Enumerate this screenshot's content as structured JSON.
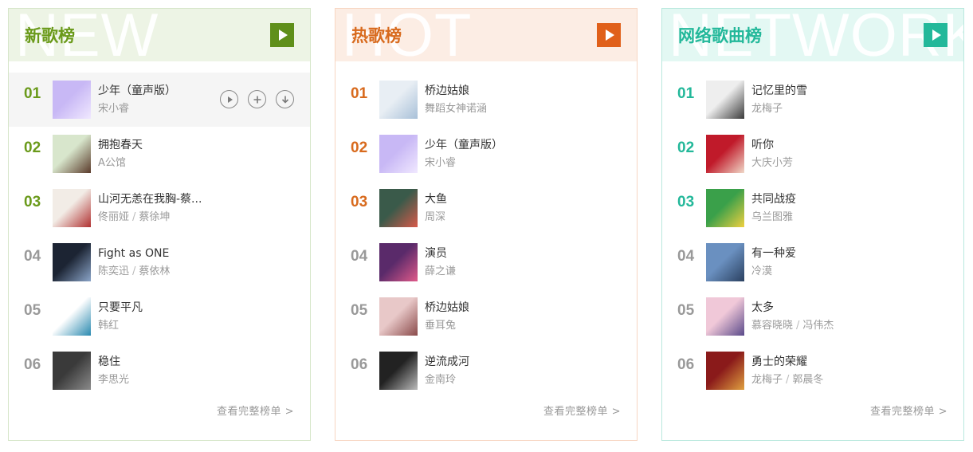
{
  "boards": [
    {
      "key": "new",
      "watermark": "NEW",
      "title": "新歌榜",
      "more_label": "查看完整榜单 >",
      "songs": [
        {
          "rank": "01",
          "name": "少年（童声版）",
          "artists": [
            "宋小睿"
          ],
          "cover": [
            "#c8b8f5",
            "#f0e8ff"
          ]
        },
        {
          "rank": "02",
          "name": "拥抱春天",
          "artists": [
            "A公馆"
          ],
          "cover": [
            "#d8e6cc",
            "#5a3a2a"
          ]
        },
        {
          "rank": "03",
          "name": "山河无恙在我胸-蔡...",
          "artists": [
            "佟丽娅",
            "蔡徐坤"
          ],
          "cover": [
            "#f2ece6",
            "#b03030"
          ]
        },
        {
          "rank": "04",
          "name": "Fight as ONE",
          "artists": [
            "陈奕迅",
            "蔡依林"
          ],
          "cover": [
            "#1c2433",
            "#8aa4c8"
          ]
        },
        {
          "rank": "05",
          "name": "只要平凡",
          "artists": [
            "韩红"
          ],
          "cover": [
            "#ffffff",
            "#2a8ab0"
          ]
        },
        {
          "rank": "06",
          "name": "稳住",
          "artists": [
            "李思光"
          ],
          "cover": [
            "#3a3a3a",
            "#8a8a8a"
          ]
        }
      ]
    },
    {
      "key": "hot",
      "watermark": "HOT",
      "title": "热歌榜",
      "more_label": "查看完整榜单 >",
      "songs": [
        {
          "rank": "01",
          "name": "桥边姑娘",
          "artists": [
            "舞蹈女神诺涵"
          ],
          "cover": [
            "#e8eef4",
            "#a8c0d8"
          ]
        },
        {
          "rank": "02",
          "name": "少年（童声版）",
          "artists": [
            "宋小睿"
          ],
          "cover": [
            "#c8b8f5",
            "#f0e8ff"
          ]
        },
        {
          "rank": "03",
          "name": "大鱼",
          "artists": [
            "周深"
          ],
          "cover": [
            "#3a5a4a",
            "#d85a4a"
          ]
        },
        {
          "rank": "04",
          "name": "演员",
          "artists": [
            "薛之谦"
          ],
          "cover": [
            "#5a2a6a",
            "#e05a8a"
          ]
        },
        {
          "rank": "05",
          "name": "桥边姑娘",
          "artists": [
            "垂耳兔"
          ],
          "cover": [
            "#e8c8c8",
            "#8a4a4a"
          ]
        },
        {
          "rank": "06",
          "name": "逆流成河",
          "artists": [
            "金南玲"
          ],
          "cover": [
            "#222222",
            "#bbbbbb"
          ]
        }
      ]
    },
    {
      "key": "net",
      "watermark": "NETWORK",
      "title": "网络歌曲榜",
      "more_label": "查看完整榜单 >",
      "songs": [
        {
          "rank": "01",
          "name": "记忆里的雪",
          "artists": [
            "龙梅子"
          ],
          "cover": [
            "#eeeeee",
            "#3a3a3a"
          ]
        },
        {
          "rank": "02",
          "name": "听你",
          "artists": [
            "大庆小芳"
          ],
          "cover": [
            "#c01a2a",
            "#f0d8c8"
          ]
        },
        {
          "rank": "03",
          "name": "共同战疫",
          "artists": [
            "乌兰图雅"
          ],
          "cover": [
            "#3aa04a",
            "#f0d040"
          ]
        },
        {
          "rank": "04",
          "name": "有一种爱",
          "artists": [
            "冷漠"
          ],
          "cover": [
            "#6a90c0",
            "#2a4060"
          ]
        },
        {
          "rank": "05",
          "name": "太多",
          "artists": [
            "慕容晓晓",
            "冯伟杰"
          ],
          "cover": [
            "#f0c8d8",
            "#5a4a8a"
          ]
        },
        {
          "rank": "06",
          "name": "勇士的荣耀",
          "artists": [
            "龙梅子",
            "郭晨冬"
          ],
          "cover": [
            "#8a1a1a",
            "#e0a040"
          ]
        }
      ]
    }
  ],
  "row_actions": [
    "play-icon",
    "add-icon",
    "download-icon"
  ]
}
